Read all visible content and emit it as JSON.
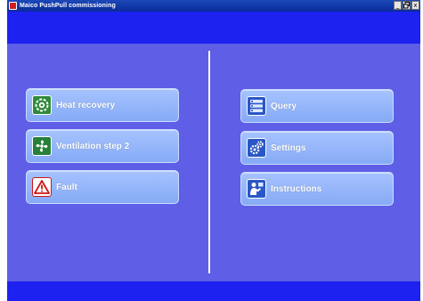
{
  "window": {
    "title": "Maico PushPull commissioning",
    "controls": {
      "minimize": "_",
      "restore": "❐",
      "close": "x"
    }
  },
  "left_menu": {
    "items": [
      {
        "label": "Heat recovery",
        "icon": "heat-recovery-icon"
      },
      {
        "label": "Ventilation step 2",
        "icon": "fan-icon"
      },
      {
        "label": "Fault",
        "icon": "warning-icon"
      }
    ]
  },
  "right_menu": {
    "items": [
      {
        "label": "Query",
        "icon": "list-icon"
      },
      {
        "label": "Settings",
        "icon": "gears-icon"
      },
      {
        "label": "Instructions",
        "icon": "instructions-icon"
      }
    ]
  },
  "colors": {
    "title_bar": "#0a2a9a",
    "band": "#1d22f0",
    "panel": "#5e5ee6",
    "button": "#96b6fa",
    "fault_red": "#d01515",
    "icon_green": "#2f8a3a",
    "icon_blue": "#2a56c6"
  }
}
